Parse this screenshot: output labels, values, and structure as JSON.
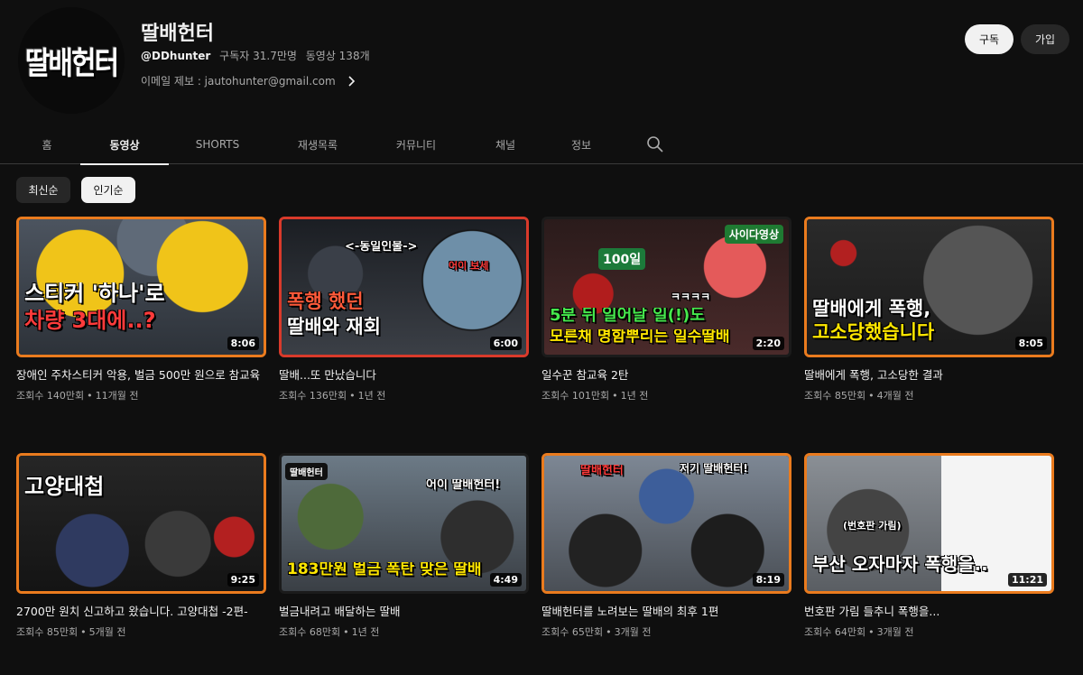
{
  "channel": {
    "name": "딸배헌터",
    "avatar_text": "딸배헌터",
    "handle": "@DDhunter",
    "subscribers": "구독자 31.7만명",
    "video_count": "동영상 138개",
    "email": "이메일 제보 : jautohunter@gmail.com",
    "subscribe_label": "구독",
    "join_label": "가입"
  },
  "tabs": [
    "홈",
    "동영상",
    "SHORTS",
    "재생목록",
    "커뮤니티",
    "채널",
    "정보"
  ],
  "sort": {
    "latest": "최신순",
    "popular": "인기순"
  },
  "videos": [
    {
      "title": "장애인 주차스티커 악용, 벌금 500만 원으로 참교육",
      "views": "조회수 140만회",
      "age": "11개월 전",
      "duration": "8:06",
      "cap1": "스티커 '하나'로",
      "cap2": "차량 3대에..?"
    },
    {
      "title": "딸배...또 만났습니다",
      "views": "조회수 136만회",
      "age": "1년 전",
      "duration": "6:00",
      "cap0": "<-동일인물->",
      "cap1": "폭행 했던",
      "cap2": "딸배와 재회",
      "cap3": "어이 보세"
    },
    {
      "title": "일수꾼 참교육 2탄",
      "views": "조회수 101만회",
      "age": "1년 전",
      "duration": "2:20",
      "cap0": "사이다영상",
      "cap1": "5분 뒤 일어날 일(!)도",
      "cap2": "모른채 명함뿌리는 일수딸배",
      "cap3": "100일",
      "cap4": "ㅋㅋㅋㅋ"
    },
    {
      "title": "딸배에게 폭행, 고소당한 결과",
      "views": "조회수 85만회",
      "age": "4개월 전",
      "duration": "8:05",
      "cap1": "딸배에게 폭행,",
      "cap2": "고소당했습니다"
    },
    {
      "title": "2700만 원치 신고하고 왔습니다. 고양대첩 -2편-",
      "views": "조회수 85만회",
      "age": "5개월 전",
      "duration": "9:25",
      "cap1": "고양대첩"
    },
    {
      "title": "벌금내려고 배달하는 딸배",
      "views": "조회수 68만회",
      "age": "1년 전",
      "duration": "4:49",
      "cap0": "딸배헌터",
      "cap1": "어이 딸배헌터!",
      "cap2": "183만원 벌금 폭탄 맞은 딸배"
    },
    {
      "title": "딸배헌터를 노려보는 딸배의 최후 1편",
      "views": "조회수 65만회",
      "age": "3개월 전",
      "duration": "8:19",
      "cap0": "딸배헌터",
      "cap1": "저기 딸배헌터!"
    },
    {
      "title": "번호판 가림 들추니 폭행을...",
      "views": "조회수 64만회",
      "age": "3개월 전",
      "duration": "11:21",
      "cap1": "부산 오자마자 폭행을..",
      "cap3": "(번호판 가림)"
    }
  ],
  "colors": {
    "background": "#0f0f0f",
    "accent_border": "#ea7b1e",
    "text": "#f1f1f1",
    "muted": "#aaaaaa"
  }
}
